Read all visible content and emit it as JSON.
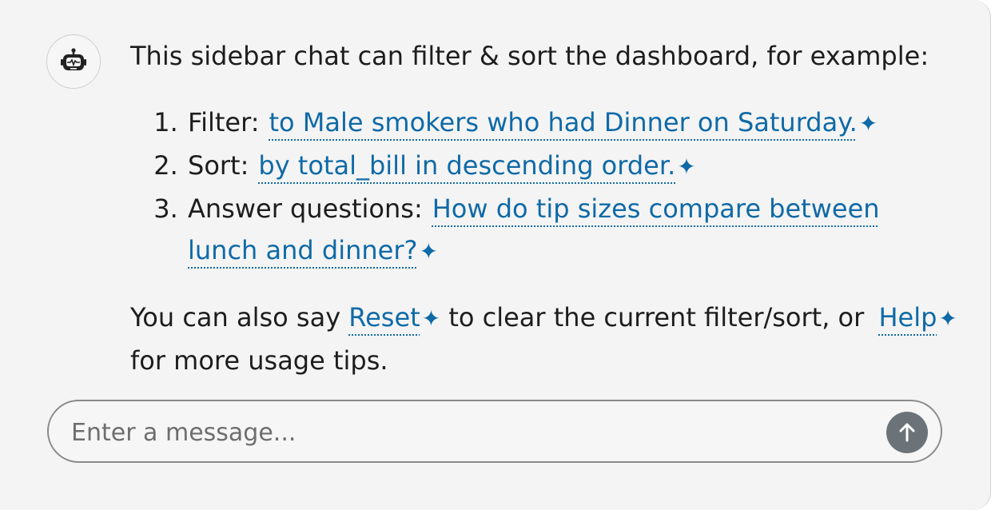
{
  "assistant": {
    "avatar_icon": "robot-icon",
    "intro": "This sidebar chat can filter & sort the dashboard, for example:",
    "examples": [
      {
        "label": "Filter:",
        "suggestion": "to Male smokers who had Dinner on Saturday."
      },
      {
        "label": "Sort:",
        "suggestion": "by total_bill in descending order."
      },
      {
        "label": "Answer questions:",
        "suggestion": "How do tip sizes compare between lunch and dinner?"
      }
    ],
    "footer": {
      "pre": "You can also say",
      "reset": "Reset",
      "mid": "to clear the current filter/sort, or",
      "help": "Help",
      "post": "for more usage tips."
    },
    "sparkle_glyph": "✦"
  },
  "composer": {
    "placeholder": "Enter a message...",
    "send_icon": "arrow-up-icon"
  },
  "colors": {
    "link": "#0f6aa7",
    "text": "#1d1d1d",
    "panel": "#f4f4f4",
    "send_button": "#6c7378"
  }
}
